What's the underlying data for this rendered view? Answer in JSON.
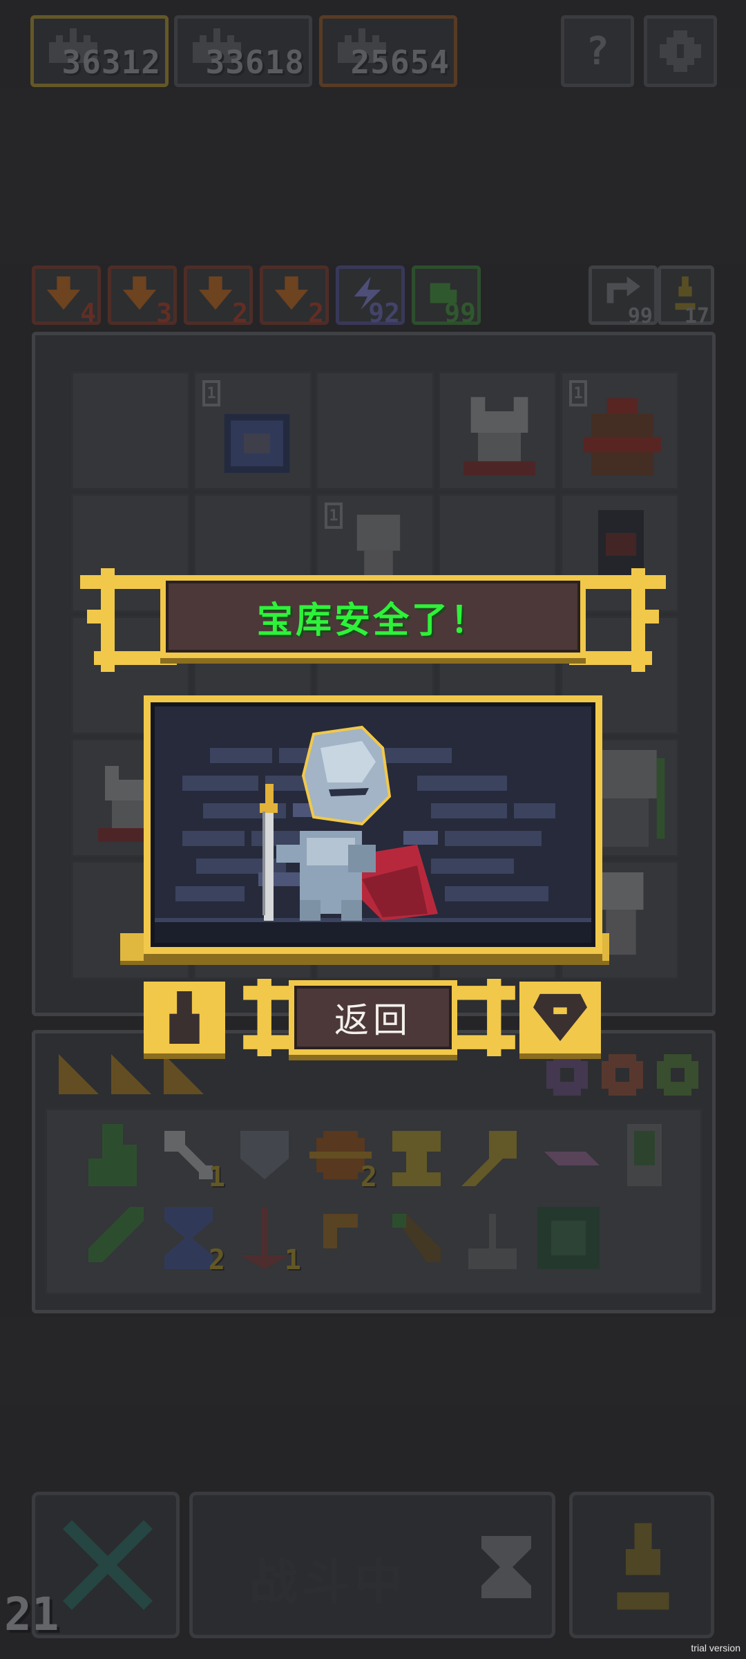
{
  "scores": [
    {
      "value": "36312",
      "color": "#8a7a30"
    },
    {
      "value": "33618",
      "color": "#55585b"
    },
    {
      "value": "25654",
      "color": "#7a4e2a"
    }
  ],
  "top_buttons": {
    "help": "?",
    "settings": "gear-icon"
  },
  "resources": [
    {
      "icon": "sword-down-icon",
      "count": "4",
      "color": "#8b3a2c"
    },
    {
      "icon": "sword-down-icon",
      "count": "3",
      "color": "#8b3a2c"
    },
    {
      "icon": "sword-down-icon",
      "count": "2",
      "color": "#8b3a2c"
    },
    {
      "icon": "sword-down-icon",
      "count": "2",
      "color": "#8b3a2c"
    },
    {
      "icon": "lightning-icon",
      "count": "92",
      "color": "#5a5a94"
    },
    {
      "icon": "potion-icon",
      "count": "99",
      "color": "#3e7a3a"
    }
  ],
  "right_resources": [
    {
      "icon": "reroll-icon",
      "count": "99"
    },
    {
      "icon": "pawn-icon",
      "count": "17"
    }
  ],
  "board": {
    "cell_levels": [
      "1",
      "1",
      "1"
    ]
  },
  "inventory": {
    "items_row1_counts": [
      "",
      "1",
      "",
      "2",
      "",
      "",
      "",
      ""
    ],
    "items_row2_counts": [
      "",
      "2",
      "1",
      "",
      "",
      "",
      ""
    ]
  },
  "dialog": {
    "title": "宝库安全了！",
    "return_label": "返回",
    "colors": {
      "gold": "#f1c84a",
      "title_text": "#2ef23a",
      "panel": "#4c3838"
    }
  },
  "bottom": {
    "turn_count": "21",
    "fighting_label": "战斗中"
  },
  "watermark": "trial version"
}
